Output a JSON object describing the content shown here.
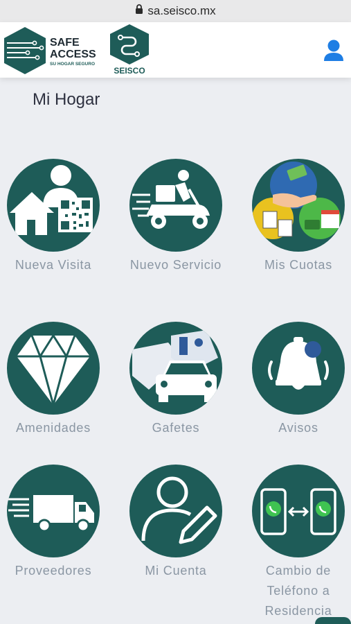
{
  "browser": {
    "url": "sa.seisco.mx"
  },
  "header": {
    "logo_safe_line1": "SAFE",
    "logo_safe_line2": "ACCESS",
    "logo_safe_tagline": "SU HOGAR SEGURO",
    "logo_seisco": "SEISCO",
    "user_icon": "user-icon"
  },
  "page": {
    "title": "Mi Hogar"
  },
  "tiles": [
    {
      "label": "Nueva Visita",
      "icon": "visitor-qr-icon"
    },
    {
      "label": "Nuevo Servicio",
      "icon": "delivery-scooter-icon"
    },
    {
      "label": "Mis Cuotas",
      "icon": "fees-payment-icon"
    },
    {
      "label": "Amenidades",
      "icon": "diamond-icon"
    },
    {
      "label": "Gafetes",
      "icon": "badge-car-icon"
    },
    {
      "label": "Avisos",
      "icon": "bell-icon"
    },
    {
      "label": "Proveedores",
      "icon": "truck-icon"
    },
    {
      "label": "Mi Cuenta",
      "icon": "edit-user-icon"
    },
    {
      "label": "Cambio de Teléfono a Residencia",
      "icon": "phone-swap-icon"
    }
  ],
  "colors": {
    "accent": "#1e5c58",
    "label": "#8a96a3",
    "background": "#eceef2",
    "user_icon": "#1e7ee4"
  }
}
